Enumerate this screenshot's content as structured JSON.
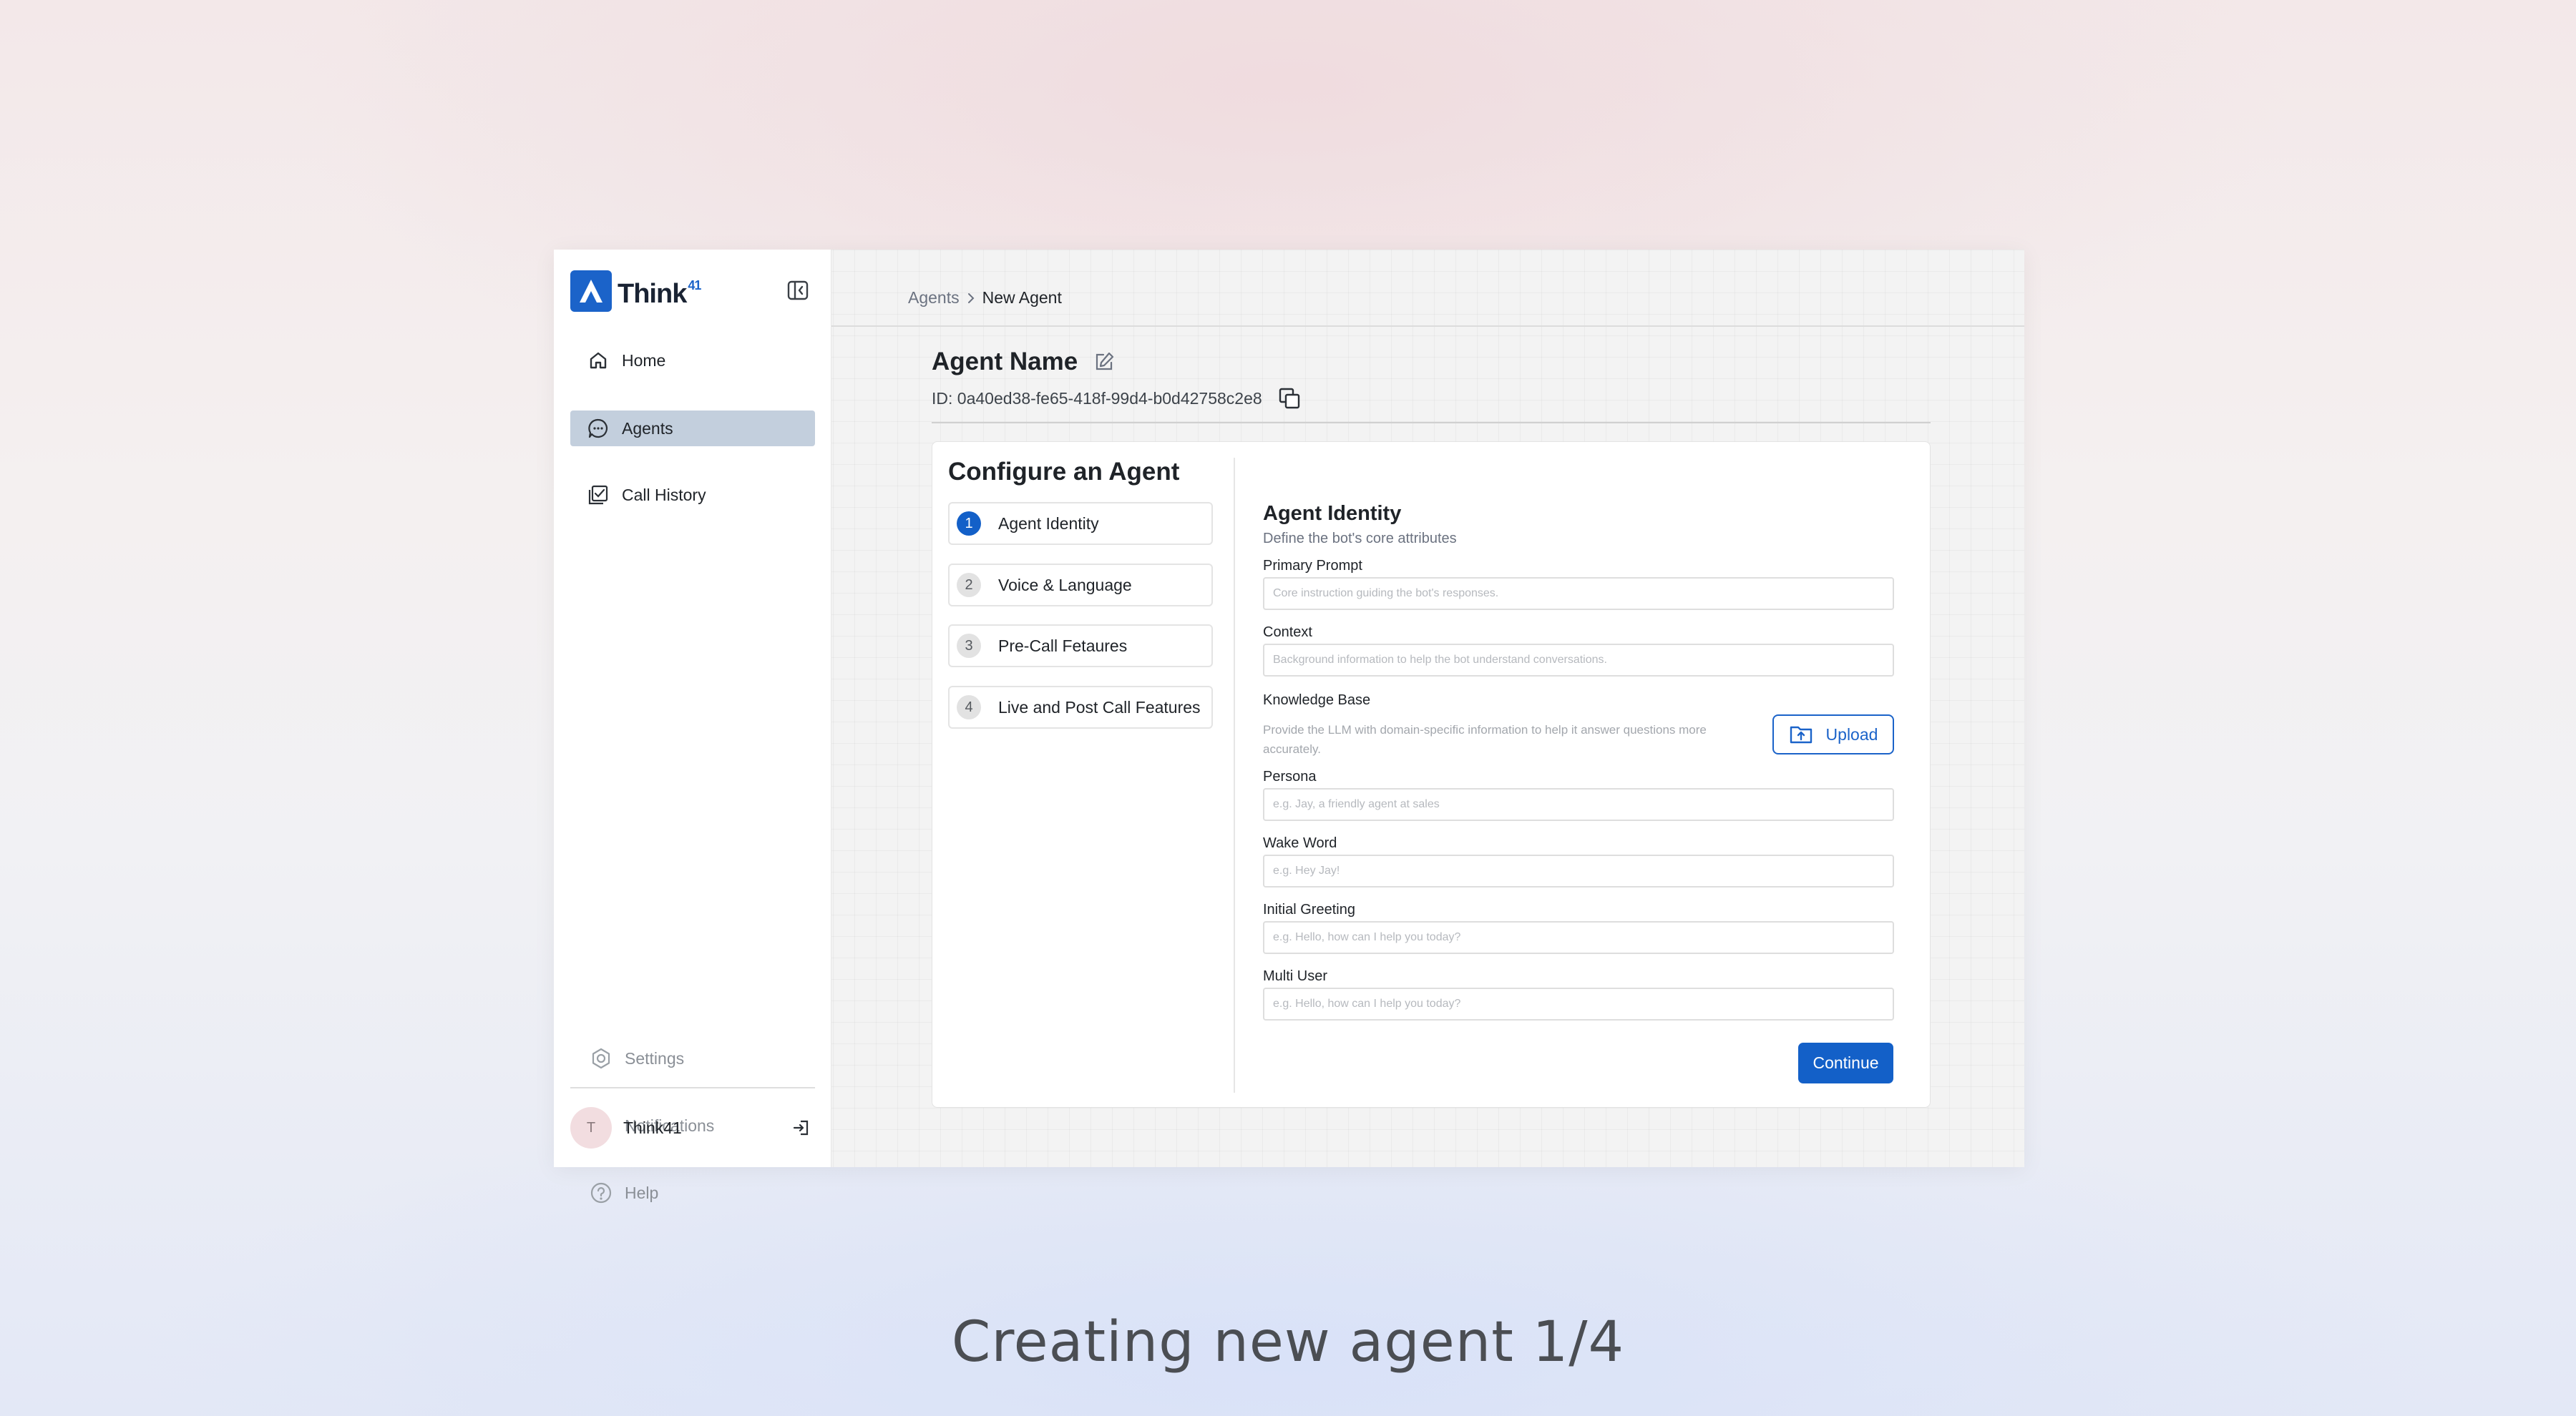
{
  "app": {
    "brand": "Think",
    "brand_superscript": "41"
  },
  "sidebar": {
    "items": [
      {
        "label": "Home",
        "icon": "home-icon",
        "active": false
      },
      {
        "label": "Agents",
        "icon": "chat-bubble-icon",
        "active": true
      },
      {
        "label": "Call History",
        "icon": "call-history-icon",
        "active": false
      }
    ],
    "bottom_items": [
      {
        "label": "Settings",
        "icon": "gear-icon"
      },
      {
        "label": "Notifications",
        "icon": "bell-icon"
      },
      {
        "label": "Help",
        "icon": "help-icon"
      }
    ],
    "user": {
      "initial": "T",
      "name": "Think41"
    }
  },
  "breadcrumb": {
    "parent": "Agents",
    "current": "New Agent"
  },
  "agent": {
    "name": "Agent Name",
    "id_text": "ID: 0a40ed38-fe65-418f-99d4-b0d42758c2e8"
  },
  "configure": {
    "title": "Configure an Agent",
    "steps": [
      {
        "number": "1",
        "label": "Agent Identity",
        "active": true
      },
      {
        "number": "2",
        "label": "Voice & Language",
        "active": false
      },
      {
        "number": "3",
        "label": "Pre-Call Fetaures",
        "active": false
      },
      {
        "number": "4",
        "label": "Live and Post Call Features",
        "active": false
      }
    ]
  },
  "form": {
    "title": "Agent Identity",
    "subtitle": "Define the bot's core attributes",
    "primary_prompt": {
      "label": "Primary Prompt",
      "value": "",
      "placeholder": "Core instruction guiding the bot's responses."
    },
    "context": {
      "label": "Context",
      "value": "",
      "placeholder": "Background information to help the bot understand conversations."
    },
    "knowledge_base": {
      "label": "Knowledge Base",
      "description": "Provide the LLM with domain-specific information to help it answer questions more accurately.",
      "upload_label": "Upload"
    },
    "persona": {
      "label": "Persona",
      "value": "",
      "placeholder": "e.g. Jay, a friendly agent at sales"
    },
    "wake_word": {
      "label": "Wake Word",
      "value": "",
      "placeholder": "e.g. Hey Jay!"
    },
    "initial_greeting": {
      "label": "Initial Greeting",
      "value": "",
      "placeholder": "e.g. Hello, how can I help you today?"
    },
    "multi_user": {
      "label": "Multi User",
      "value": "",
      "placeholder": "e.g. Hello, how can I help you today?"
    },
    "continue_label": "Continue"
  },
  "caption": "Creating new agent 1/4",
  "colors": {
    "accent": "#1360c8",
    "active_nav": "#c3cfdd",
    "avatar_bg": "#f2dde0"
  }
}
